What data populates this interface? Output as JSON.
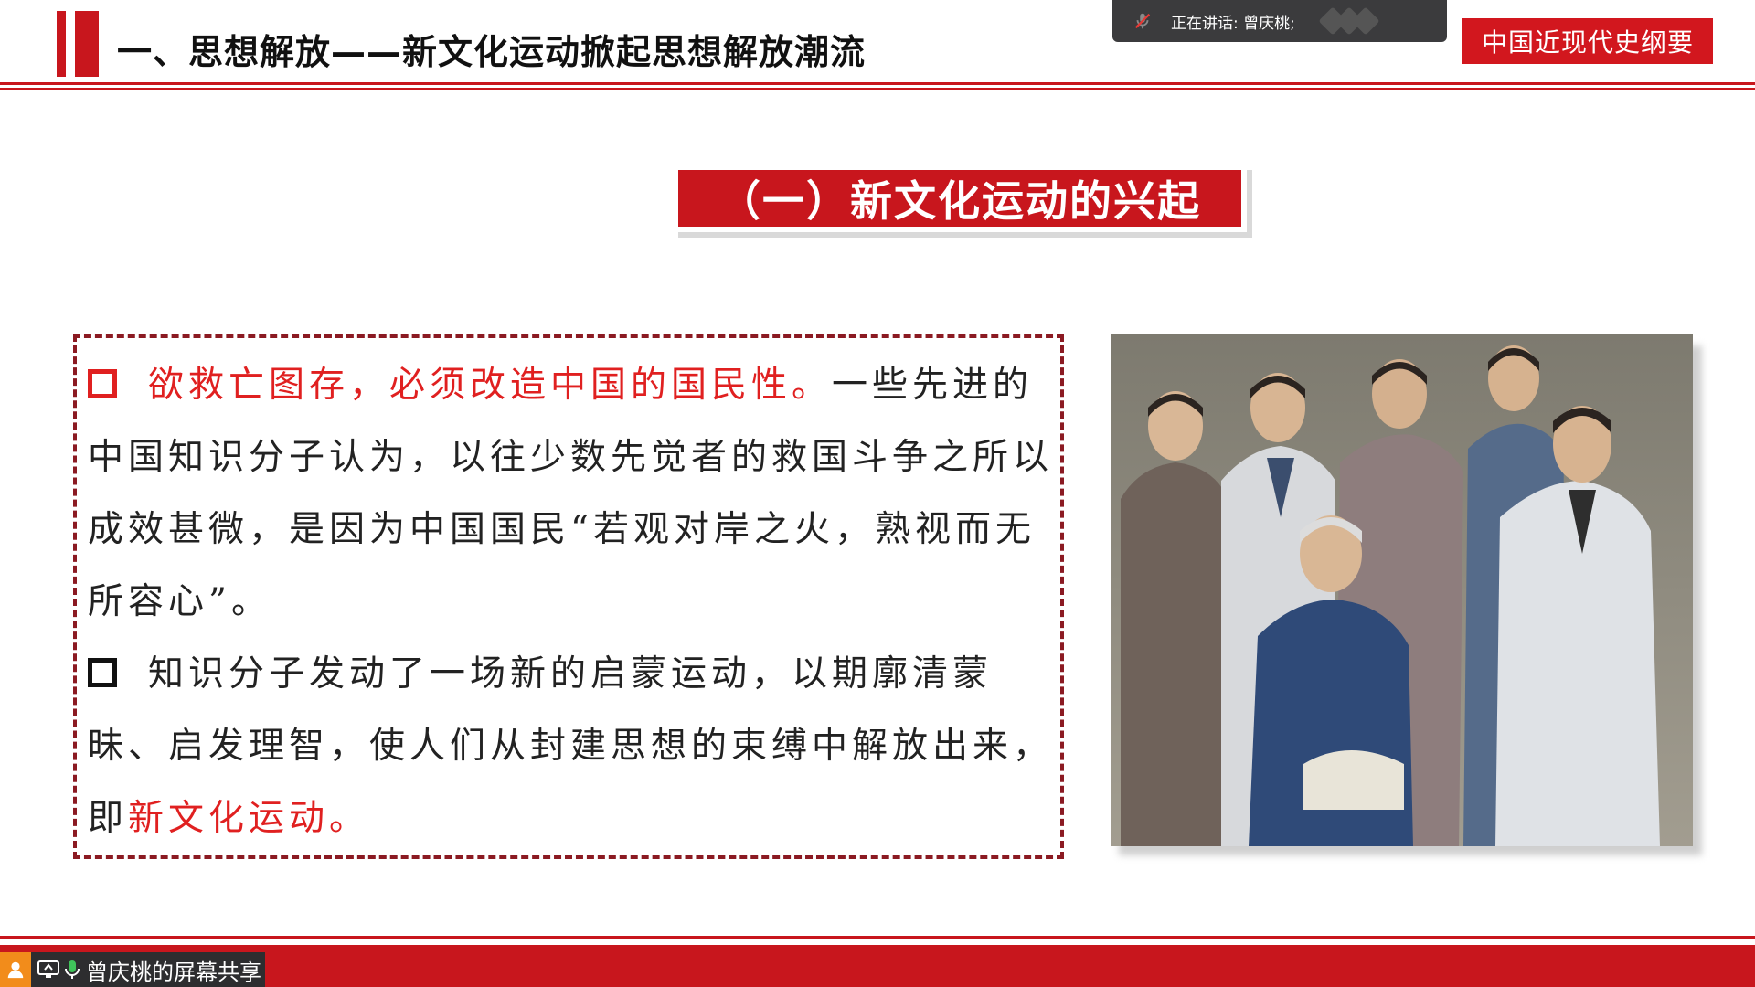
{
  "header": {
    "title": "一、思想解放——新文化运动掀起思想解放潮流",
    "course_badge": "中国近现代史纲要"
  },
  "meeting": {
    "speaking_text": "正在讲话: 曾庆桃;",
    "share_label": "曾庆桃的屏幕共享"
  },
  "section": {
    "heading": "（一）新文化运动的兴起"
  },
  "content": {
    "p1_highlight": "欲救亡图存，必须改造中国的国民性。",
    "p1_rest": "一些先进的中国知识分子认为，以往少数先觉者的救国斗争之所以成效甚微，是因为中国国民“若观对岸之火，熟视而无所容心”。",
    "p2_text": "知识分子发动了一场新的启蒙运动，以期廓清蒙昧、启发理智，使人们从封建思想的束缚中解放出来，即",
    "p2_highlight": "新文化运动。"
  },
  "colors": {
    "brand_red": "#c8161d",
    "highlight_red": "#e02020",
    "overlay_gray": "#3b3b3d",
    "share_orange": "#f28c1b"
  },
  "icons": [
    "mic-off-icon",
    "user-icon",
    "screen-share-icon",
    "mic-icon",
    "bullet-square-icon"
  ]
}
